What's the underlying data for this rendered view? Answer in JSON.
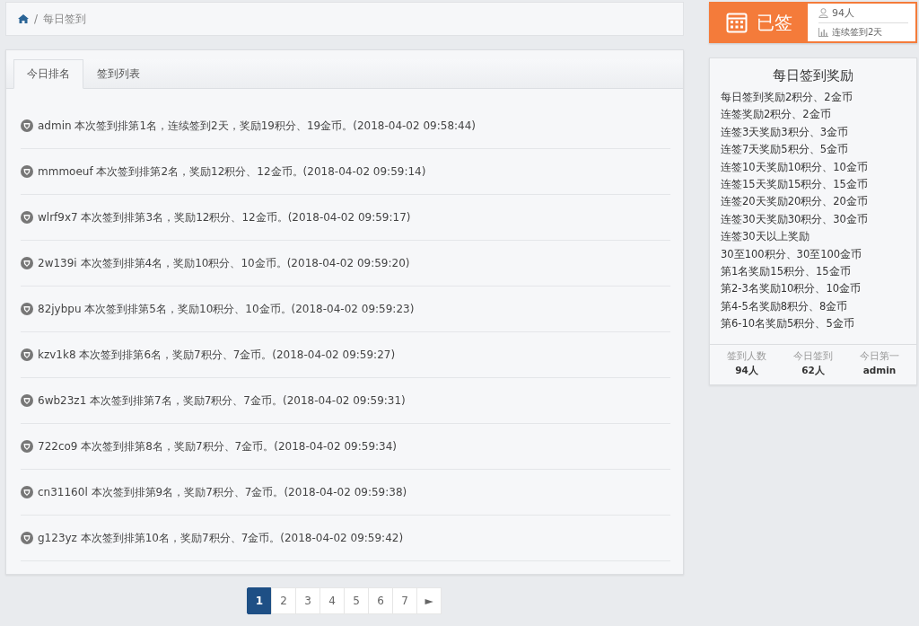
{
  "breadcrumb": {
    "separator": "/",
    "current": "每日签到"
  },
  "tabs": [
    {
      "label": "今日排名",
      "selected": true
    },
    {
      "label": "签到列表",
      "selected": false
    }
  ],
  "rankings": [
    "admin 本次签到排第1名，连续签到2天，奖励19积分、19金币。(2018-04-02 09:58:44)",
    "mmmoeuf 本次签到排第2名，奖励12积分、12金币。(2018-04-02 09:59:14)",
    "wlrf9x7 本次签到排第3名，奖励12积分、12金币。(2018-04-02 09:59:17)",
    "2w139i 本次签到排第4名，奖励10积分、10金币。(2018-04-02 09:59:20)",
    "82jybpu 本次签到排第5名，奖励10积分、10金币。(2018-04-02 09:59:23)",
    "kzv1k8 本次签到排第6名，奖励7积分、7金币。(2018-04-02 09:59:27)",
    "6wb23z1 本次签到排第7名，奖励7积分、7金币。(2018-04-02 09:59:31)",
    "722co9 本次签到排第8名，奖励7积分、7金币。(2018-04-02 09:59:34)",
    "cn31160l 本次签到排第9名，奖励7积分、7金币。(2018-04-02 09:59:38)",
    "g123yz 本次签到排第10名，奖励7积分、7金币。(2018-04-02 09:59:42)"
  ],
  "pagination": [
    {
      "label": "1",
      "selected": true
    },
    {
      "label": "2",
      "selected": false
    },
    {
      "label": "3",
      "selected": false
    },
    {
      "label": "4",
      "selected": false
    },
    {
      "label": "5",
      "selected": false
    },
    {
      "label": "6",
      "selected": false
    },
    {
      "label": "7",
      "selected": false
    },
    {
      "label": "►",
      "selected": false
    }
  ],
  "signin_badge": {
    "label": "已签",
    "members": "94人",
    "streak": "连续签到2天"
  },
  "rewards": {
    "title": "每日签到奖励",
    "lines": [
      "每日签到奖励2积分、2金币",
      "连签奖励2积分、2金币",
      "连签3天奖励3积分、3金币",
      "连签7天奖励5积分、5金币",
      "连签10天奖励10积分、10金币",
      "连签15天奖励15积分、15金币",
      "连签20天奖励20积分、20金币",
      "连签30天奖励30积分、30金币",
      "连签30天以上奖励",
      "30至100积分、30至100金币",
      "第1名奖励15积分、15金币",
      "第2-3名奖励10积分、10金币",
      "第4-5名奖励8积分、8金币",
      "第6-10名奖励5积分、5金币"
    ],
    "stats": [
      {
        "label": "签到人数",
        "value": "94人"
      },
      {
        "label": "今日签到",
        "value": "62人"
      },
      {
        "label": "今日第一",
        "value": "admin"
      }
    ]
  }
}
